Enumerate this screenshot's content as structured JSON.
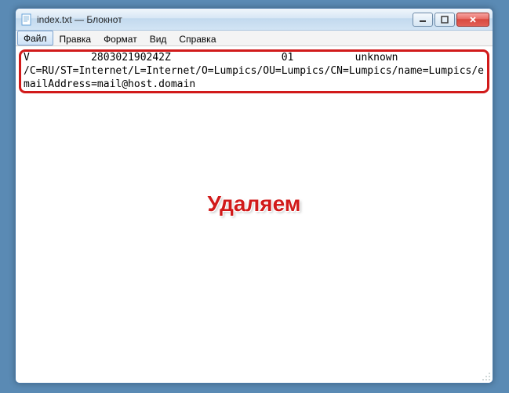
{
  "window": {
    "title": "index.txt — Блокнот"
  },
  "menu": {
    "file": "Файл",
    "edit": "Правка",
    "format": "Формат",
    "view": "Вид",
    "help": "Справка"
  },
  "content": {
    "line1": "V          280302190242Z                  01          unknown",
    "line2": "/C=RU/ST=Internet/L=Internet/O=Lumpics/OU=Lumpics/CN=Lumpics/name=Lumpics/emailAddress=mail@host.domain"
  },
  "annotation": {
    "label": "Удаляем"
  },
  "win_buttons": {
    "min": "—",
    "max": "▭",
    "close": "✕"
  }
}
